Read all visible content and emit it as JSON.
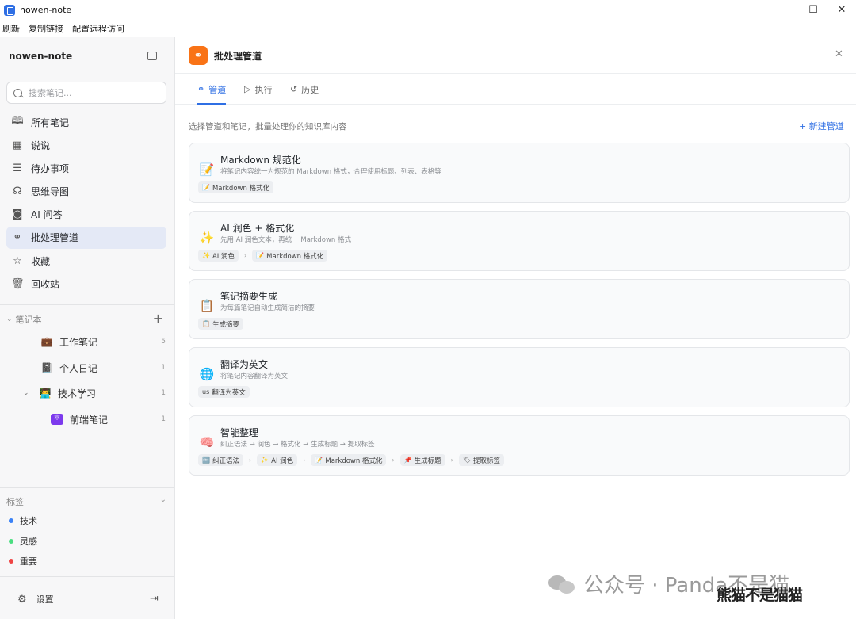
{
  "window": {
    "title": "nowen-note",
    "controls": [
      "—",
      "☐",
      "✕"
    ]
  },
  "menu": [
    "刷新",
    "复制链接",
    "配置远程访问"
  ],
  "sidebar": {
    "app_name": "nowen-note",
    "search_placeholder": "搜索笔记...",
    "nav": [
      {
        "label": "所有笔记",
        "icon": "book-icon",
        "glyph": "🕮"
      },
      {
        "label": "说说",
        "icon": "calendar-icon",
        "glyph": "▦"
      },
      {
        "label": "待办事项",
        "icon": "checklist-icon",
        "glyph": "☰"
      },
      {
        "label": "思维导图",
        "icon": "brain-icon",
        "glyph": "☊"
      },
      {
        "label": "AI 问答",
        "icon": "bot-icon",
        "glyph": "◙"
      },
      {
        "label": "批处理管道",
        "icon": "pipeline-icon",
        "glyph": "⚭",
        "active": true
      },
      {
        "label": "收藏",
        "icon": "star-icon",
        "glyph": "☆"
      },
      {
        "label": "回收站",
        "icon": "trash-icon",
        "glyph": "🗑"
      }
    ],
    "notebooks_header": "笔记本",
    "notebooks": [
      {
        "label": "工作笔记",
        "emoji": "💼",
        "count": "5"
      },
      {
        "label": "个人日记",
        "emoji": "📓",
        "count": "1"
      },
      {
        "label": "技术学习",
        "emoji": "👨‍💻",
        "count": "1",
        "expanded": true
      },
      {
        "label": "前端笔记",
        "emoji": "⚛",
        "count": "1"
      }
    ],
    "tags_header": "标签",
    "tags": [
      {
        "label": "技术",
        "color": "#3b82f6"
      },
      {
        "label": "灵感",
        "color": "#4ade80"
      },
      {
        "label": "重要",
        "color": "#ef4444"
      }
    ],
    "settings_label": "设置"
  },
  "main": {
    "title": "批处理管道",
    "tabs": [
      {
        "label": "管道",
        "icon": "⚭",
        "active": true
      },
      {
        "label": "执行",
        "icon": "▷"
      },
      {
        "label": "历史",
        "icon": "↺"
      }
    ],
    "subtitle": "选择管道和笔记，批量处理你的知识库内容",
    "new_pipeline": "+ 新建管道",
    "pipelines": [
      {
        "title": "Markdown 规范化",
        "emoji": "📝",
        "desc": "将笔记内容统一为规范的 Markdown 格式，合理使用标题、列表、表格等",
        "steps": [
          {
            "emoji": "📝",
            "label": "Markdown 格式化"
          }
        ]
      },
      {
        "title": "AI 润色 + 格式化",
        "emoji": "✨",
        "desc": "先用 AI 润色文本，再统一 Markdown 格式",
        "steps": [
          {
            "emoji": "✨",
            "label": "AI 润色"
          },
          {
            "emoji": "📝",
            "label": "Markdown 格式化"
          }
        ]
      },
      {
        "title": "笔记摘要生成",
        "emoji": "📋",
        "desc": "为每篇笔记自动生成简洁的摘要",
        "steps": [
          {
            "emoji": "📋",
            "label": "生成摘要"
          }
        ]
      },
      {
        "title": "翻译为英文",
        "emoji": "🌐",
        "desc": "将笔记内容翻译为英文",
        "steps": [
          {
            "emoji": "us",
            "label": "翻译为英文"
          }
        ]
      },
      {
        "title": "智能整理",
        "emoji": "🧠",
        "desc": "纠正语法 → 润色 → 格式化 → 生成标题 → 提取标签",
        "steps": [
          {
            "emoji": "🔤",
            "label": "纠正语法"
          },
          {
            "emoji": "✨",
            "label": "AI 润色"
          },
          {
            "emoji": "📝",
            "label": "Markdown 格式化"
          },
          {
            "emoji": "📌",
            "label": "生成标题"
          },
          {
            "emoji": "🏷",
            "label": "提取标签"
          }
        ]
      }
    ]
  },
  "watermark": {
    "text": "公众号 · Panda不是猫",
    "sub": "熊猫不是猫猫"
  }
}
